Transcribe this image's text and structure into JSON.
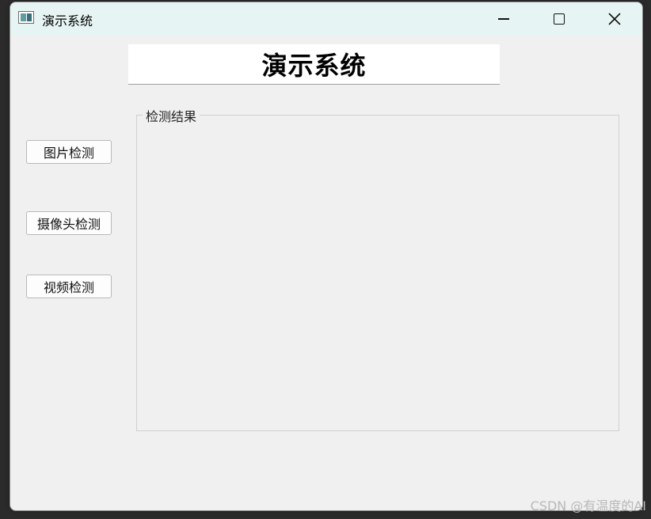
{
  "window": {
    "title": "演示系统"
  },
  "header": {
    "title": "演示系统"
  },
  "sidebar": {
    "buttons": [
      {
        "label": "图片检测"
      },
      {
        "label": "摄像头检测"
      },
      {
        "label": "视频检测"
      }
    ]
  },
  "result_panel": {
    "label": "检测结果"
  },
  "watermark": "CSDN @有温度的AI"
}
